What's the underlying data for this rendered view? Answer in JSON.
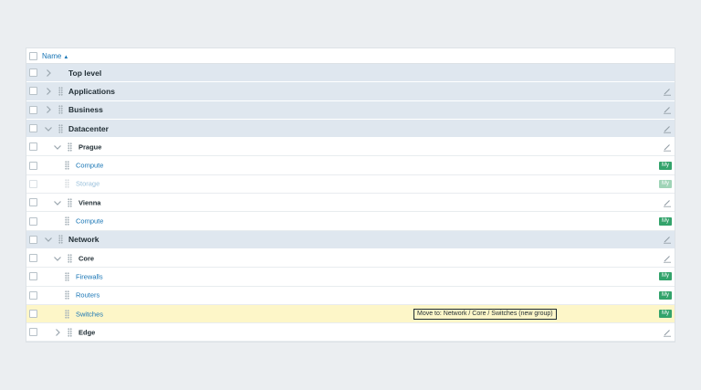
{
  "header": {
    "sort_label": "Name",
    "sort_arrow": "▲"
  },
  "rows": [
    {
      "label": "Top level",
      "level": "top",
      "chevron": "right",
      "grip": false,
      "edit": false,
      "badge": ""
    },
    {
      "label": "Applications",
      "level": "top",
      "chevron": "right",
      "grip": true,
      "edit": true,
      "badge": ""
    },
    {
      "label": "Business",
      "level": "top",
      "chevron": "right",
      "grip": true,
      "edit": true,
      "badge": ""
    },
    {
      "label": "Datacenter",
      "level": "top",
      "chevron": "down",
      "grip": true,
      "edit": true,
      "badge": ""
    },
    {
      "label": "Prague",
      "level": "sub",
      "chevron": "down",
      "grip": true,
      "edit": true,
      "badge": ""
    },
    {
      "label": "Compute",
      "level": "leaf",
      "chevron": "",
      "grip": true,
      "edit": false,
      "badge": "My"
    },
    {
      "label": "Storage",
      "level": "leaf",
      "chevron": "",
      "grip": true,
      "edit": false,
      "badge": "My",
      "dim": true
    },
    {
      "label": "Vienna",
      "level": "sub",
      "chevron": "down",
      "grip": true,
      "edit": true,
      "badge": ""
    },
    {
      "label": "Compute",
      "level": "leaf",
      "chevron": "",
      "grip": true,
      "edit": false,
      "badge": "My"
    },
    {
      "label": "Network",
      "level": "top",
      "chevron": "down",
      "grip": true,
      "edit": true,
      "badge": ""
    },
    {
      "label": "Core",
      "level": "sub",
      "chevron": "down",
      "grip": true,
      "edit": true,
      "badge": ""
    },
    {
      "label": "Firewalls",
      "level": "leaf",
      "chevron": "",
      "grip": true,
      "edit": false,
      "badge": "My"
    },
    {
      "label": "Routers",
      "level": "leaf",
      "chevron": "",
      "grip": true,
      "edit": false,
      "badge": "My"
    },
    {
      "label": "Switches",
      "level": "leaf",
      "chevron": "",
      "grip": true,
      "edit": false,
      "badge": "My",
      "highlight": true,
      "tooltip": "Move to: Network / Core / Switches (new group)"
    },
    {
      "label": "Edge",
      "level": "sub",
      "chevron": "right",
      "grip": true,
      "edit": true,
      "badge": ""
    }
  ],
  "colors": {
    "link": "#1875b5",
    "badge": "#33a36b",
    "group_bg": "#dfe7ef",
    "highlight_bg": "#fdf6c8"
  },
  "icons": {
    "expand": "chevron-right-icon",
    "collapse": "chevron-down-icon",
    "edit": "pencil-icon",
    "drag": "drag-handle-icon"
  }
}
